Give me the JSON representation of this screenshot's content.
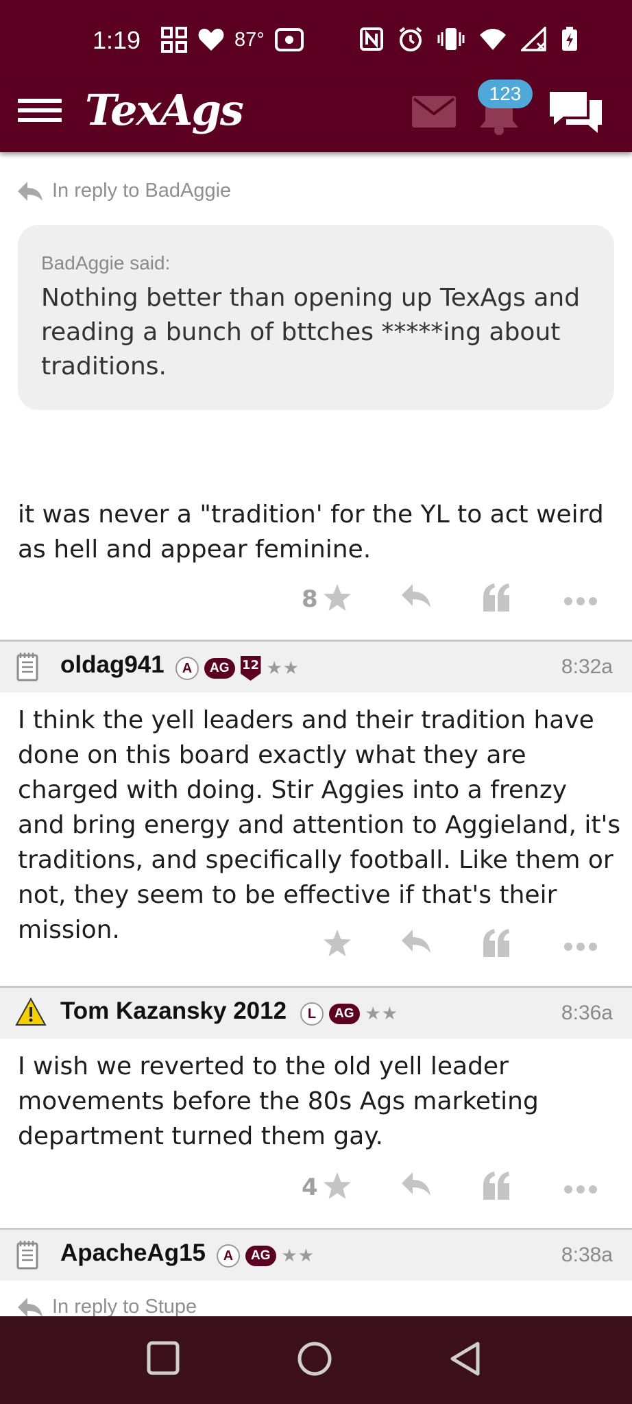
{
  "status_bar": {
    "time": "1:19",
    "temperature": "87°",
    "icons_left": [
      "grid-icon",
      "heart-icon",
      "radio-icon"
    ],
    "icons_right": [
      "nfc-icon",
      "alarm-icon",
      "vibrate-icon",
      "wifi-icon",
      "signal-icon",
      "battery-charging-icon"
    ]
  },
  "header": {
    "logo": "TexAgs",
    "notification_count": "123",
    "colors": {
      "brand": "#5b0020",
      "badge": "#4ea8d8"
    }
  },
  "reply_context": {
    "text": "In reply to BadAggie"
  },
  "quote": {
    "author": "BadAggie said:",
    "text": "Nothing better than opening up TexAgs and reading a bunch of bttches *****ing about traditions."
  },
  "posts": [
    {
      "body": "it was never a \"tradition' for the YL to act weird as hell and appear feminine.",
      "star_count": "8"
    },
    {
      "username": "oldag941",
      "badges": [
        "A",
        "AG",
        "12",
        "★★"
      ],
      "time": "8:32a",
      "body": "I think the yell leaders and their tradition have done on this board exactly what they are charged with doing. Stir Aggies into a frenzy and bring energy and attention to Aggieland, it's traditions, and specifically football. Like them or not, they seem to be effective if that's their mission.",
      "star_count": ""
    },
    {
      "username": "Tom Kazansky 2012",
      "badges": [
        "L",
        "AG",
        "★★"
      ],
      "time": "8:36a",
      "body": "I wish we reverted to the old yell leader movements before the 80s Ags marketing department turned them gay.",
      "star_count": "4"
    },
    {
      "username": "ApacheAg15",
      "badges": [
        "A",
        "AG",
        "★★"
      ],
      "time": "8:38a"
    }
  ],
  "next_reply": {
    "text": "In reply to Stupe"
  },
  "nav": {
    "icons": [
      "recent-apps-icon",
      "home-icon",
      "back-icon"
    ]
  }
}
